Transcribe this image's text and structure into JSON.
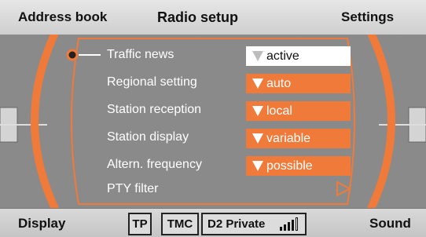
{
  "header": {
    "left": "Address book",
    "title": "Radio setup",
    "right": "Settings"
  },
  "menu": [
    {
      "label": "Traffic news",
      "value": "active",
      "selected": true
    },
    {
      "label": "Regional setting",
      "value": "auto"
    },
    {
      "label": "Station reception",
      "value": "local"
    },
    {
      "label": "Station display",
      "value": "variable"
    },
    {
      "label": "Altern. frequency",
      "value": "possible"
    },
    {
      "label": "PTY filter"
    }
  ],
  "footer": {
    "left": "Display",
    "right": "Sound",
    "tp": "TP",
    "tmc": "TMC",
    "station": "D2 Private"
  },
  "signal": {
    "level": 4,
    "max": 5
  },
  "colors": {
    "accent": "#f07a3a",
    "panel": "#8a8a8a"
  }
}
